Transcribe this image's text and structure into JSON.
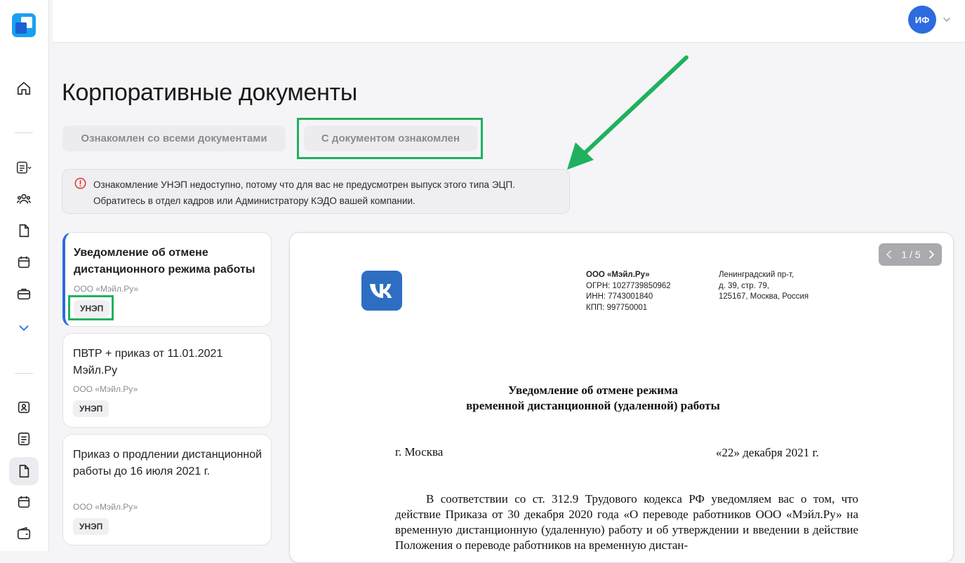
{
  "header": {
    "avatar_initials": "ИФ"
  },
  "page": {
    "title": "Корпоративные документы"
  },
  "actions": {
    "ack_all_label": "Ознакомлен со всеми документами",
    "ack_one_label": "С документом ознакомлен"
  },
  "alert": {
    "line1": "Ознакомление УНЭП недоступно, потому что для вас не предусмотрен выпуск этого типа ЭЦП.",
    "line2": "Обратитесь в отдел кадров или Администратору КЭДО вашей компании."
  },
  "documents": [
    {
      "title": "Уведомление об отмене дистанционного режима работы",
      "org": "ООО «Мэйл.Ру»",
      "tag": "УНЭП"
    },
    {
      "title": "ПВТР + приказ от 11.01.2021 Мэйл.Ру",
      "org": "ООО «Мэйл.Ру»",
      "tag": "УНЭП"
    },
    {
      "title": "Приказ о продлении дистанционной работы до 16 июля 2021 г.",
      "org": "ООО «Мэйл.Ру»",
      "tag": "УНЭП"
    }
  ],
  "viewer": {
    "pager": "1 / 5",
    "org_lines": [
      "ООО «Мэйл.Ру»",
      "ОГРН: 1027739850962",
      "ИНН: 7743001840",
      "КПП: 997750001"
    ],
    "addr_lines": [
      "Ленинградский пр-т,",
      "д. 39, стр. 79,",
      "125167, Москва, Россия"
    ],
    "doc_title_line1": "Уведомление об отмене режима",
    "doc_title_line2": "временной дистанционной (удаленной) работы",
    "city": "г. Москва",
    "date": "«22» декабря 2021 г.",
    "body": "В соответствии со ст. 312.9 Трудового кодекса РФ уведомляем вас о том, что действие Приказа от 30 декабря 2020 года «О переводе работников ООО «Мэйл.Ру» на временную дистанционную (удаленную) работу и об утверждении и введении в действие Положения о переводе работников на временную дистан-"
  },
  "colors": {
    "accent": "#2c6be0",
    "highlight": "#1fb15e",
    "vk_blue": "#2d6ec3",
    "alert_red": "#e03b3b"
  }
}
